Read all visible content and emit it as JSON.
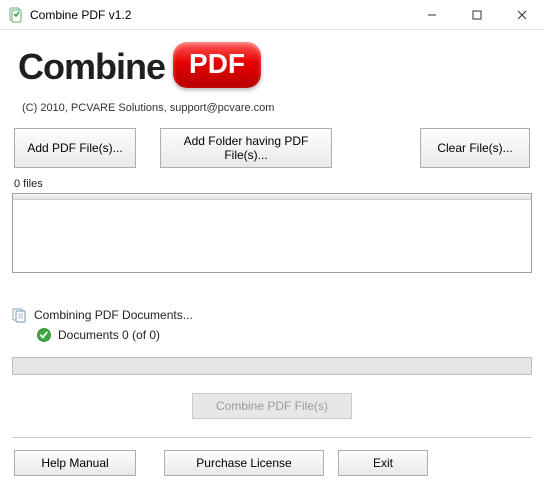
{
  "window": {
    "title": "Combine PDF v1.2"
  },
  "logo": {
    "word": "Combine",
    "badge": "PDF"
  },
  "copyright": "(C) 2010, PCVARE Solutions, support@pcvare.com",
  "buttons": {
    "add_pdf": "Add PDF File(s)...",
    "add_folder": "Add Folder having PDF File(s)...",
    "clear": "Clear File(s)...",
    "combine": "Combine PDF File(s)",
    "help": "Help Manual",
    "purchase": "Purchase License",
    "exit": "Exit"
  },
  "files": {
    "count_label": "0 files",
    "items": []
  },
  "status": {
    "combining_label": "Combining PDF Documents...",
    "documents_label": "Documents 0 (of 0)",
    "progress_percent": 0
  }
}
